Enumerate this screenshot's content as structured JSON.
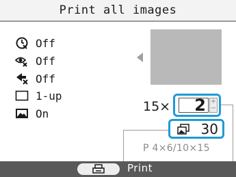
{
  "header": {
    "title": "Print all images"
  },
  "settings": [
    {
      "icon": "date-print-icon",
      "value": "Off"
    },
    {
      "icon": "red-eye-correction-icon",
      "value": "Off"
    },
    {
      "icon": "image-correction-icon",
      "value": "Off"
    },
    {
      "icon": "layout-icon",
      "value": "1-up"
    },
    {
      "icon": "border-icon",
      "value": "On"
    }
  ],
  "copies": {
    "prefix": "15×",
    "value": "2",
    "plus": "+",
    "minus": "−"
  },
  "total": {
    "icon": "total-prints-icon",
    "value": "30"
  },
  "paper": {
    "label": "P 4×6/10×15"
  },
  "footer": {
    "button_icon": "print-button-icon",
    "label": "Print"
  },
  "colors": {
    "highlight": "#1e9ad6",
    "footer_bg": "#595959",
    "preview_bg": "#b9b9b9"
  }
}
